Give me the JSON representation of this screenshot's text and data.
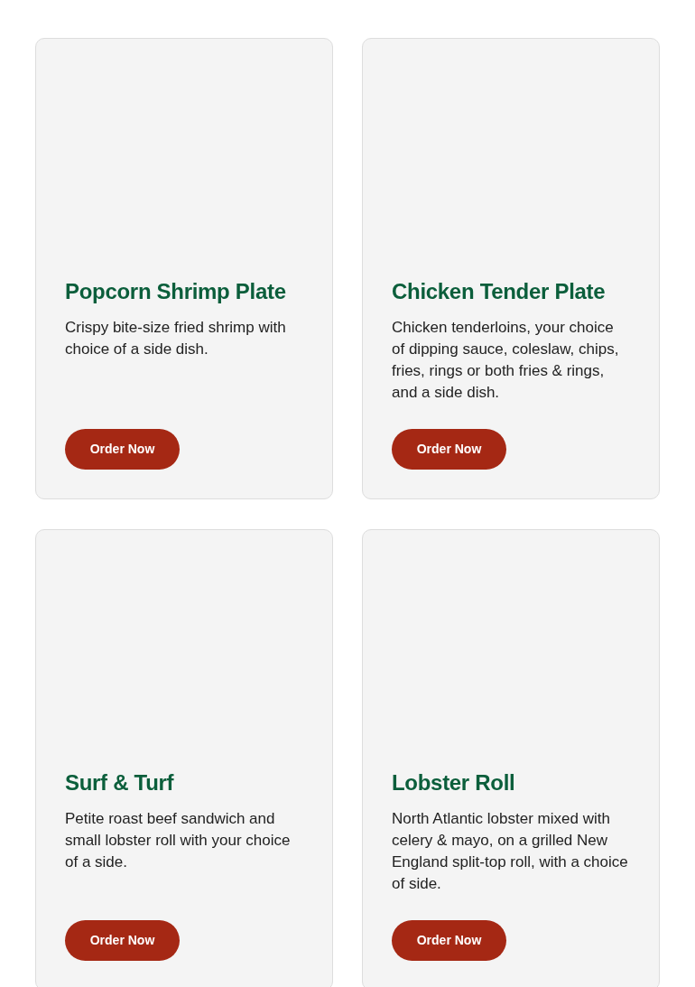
{
  "menu_items": [
    {
      "title": "Popcorn Shrimp Plate",
      "description": "Crispy bite-size fried shrimp with choice of a side dish.",
      "button": "Order Now"
    },
    {
      "title": "Chicken Tender Plate",
      "description": "Chicken tenderloins, your choice of dipping sauce, coleslaw, chips, fries, rings or both fries & rings, and a side dish.",
      "button": "Order Now"
    },
    {
      "title": "Surf & Turf",
      "description": "Petite roast beef sandwich and small lobster roll with your choice of a side.",
      "button": "Order Now"
    },
    {
      "title": "Lobster Roll",
      "description": "North Atlantic lobster mixed with celery & mayo, on a grilled New England split-top roll, with a choice of side.",
      "button": "Order Now"
    }
  ]
}
